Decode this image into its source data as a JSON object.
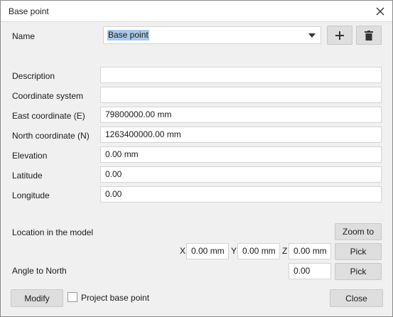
{
  "window": {
    "title": "Base point"
  },
  "name_row": {
    "label": "Name",
    "value": "Base point"
  },
  "fields": {
    "description": {
      "label": "Description",
      "value": ""
    },
    "coordinate_system": {
      "label": "Coordinate system",
      "value": ""
    },
    "east": {
      "label": "East coordinate  (E)",
      "value": "79800000.00 mm"
    },
    "north": {
      "label": "North coordinate  (N)",
      "value": "1263400000.00 mm"
    },
    "elevation": {
      "label": "Elevation",
      "value": "0.00 mm"
    },
    "latitude": {
      "label": "Latitude",
      "value": "0.00"
    },
    "longitude": {
      "label": "Longitude",
      "value": "0.00"
    }
  },
  "location": {
    "label": "Location in the model",
    "zoom_label": "Zoom to",
    "x_label": "X",
    "x_value": "0.00 mm",
    "y_label": "Y",
    "y_value": "0.00 mm",
    "z_label": "Z",
    "z_value": "0.00 mm",
    "pick_label": "Pick"
  },
  "angle": {
    "label": "Angle to North",
    "value": "0.00",
    "pick_label": "Pick"
  },
  "footer": {
    "modify_label": "Modify",
    "project_base_point_label": "Project base point",
    "project_base_point_checked": false,
    "close_label": "Close"
  },
  "icons": {
    "close": "close-icon",
    "add": "plus-icon",
    "delete": "trash-icon",
    "dropdown": "chevron-down-icon"
  }
}
